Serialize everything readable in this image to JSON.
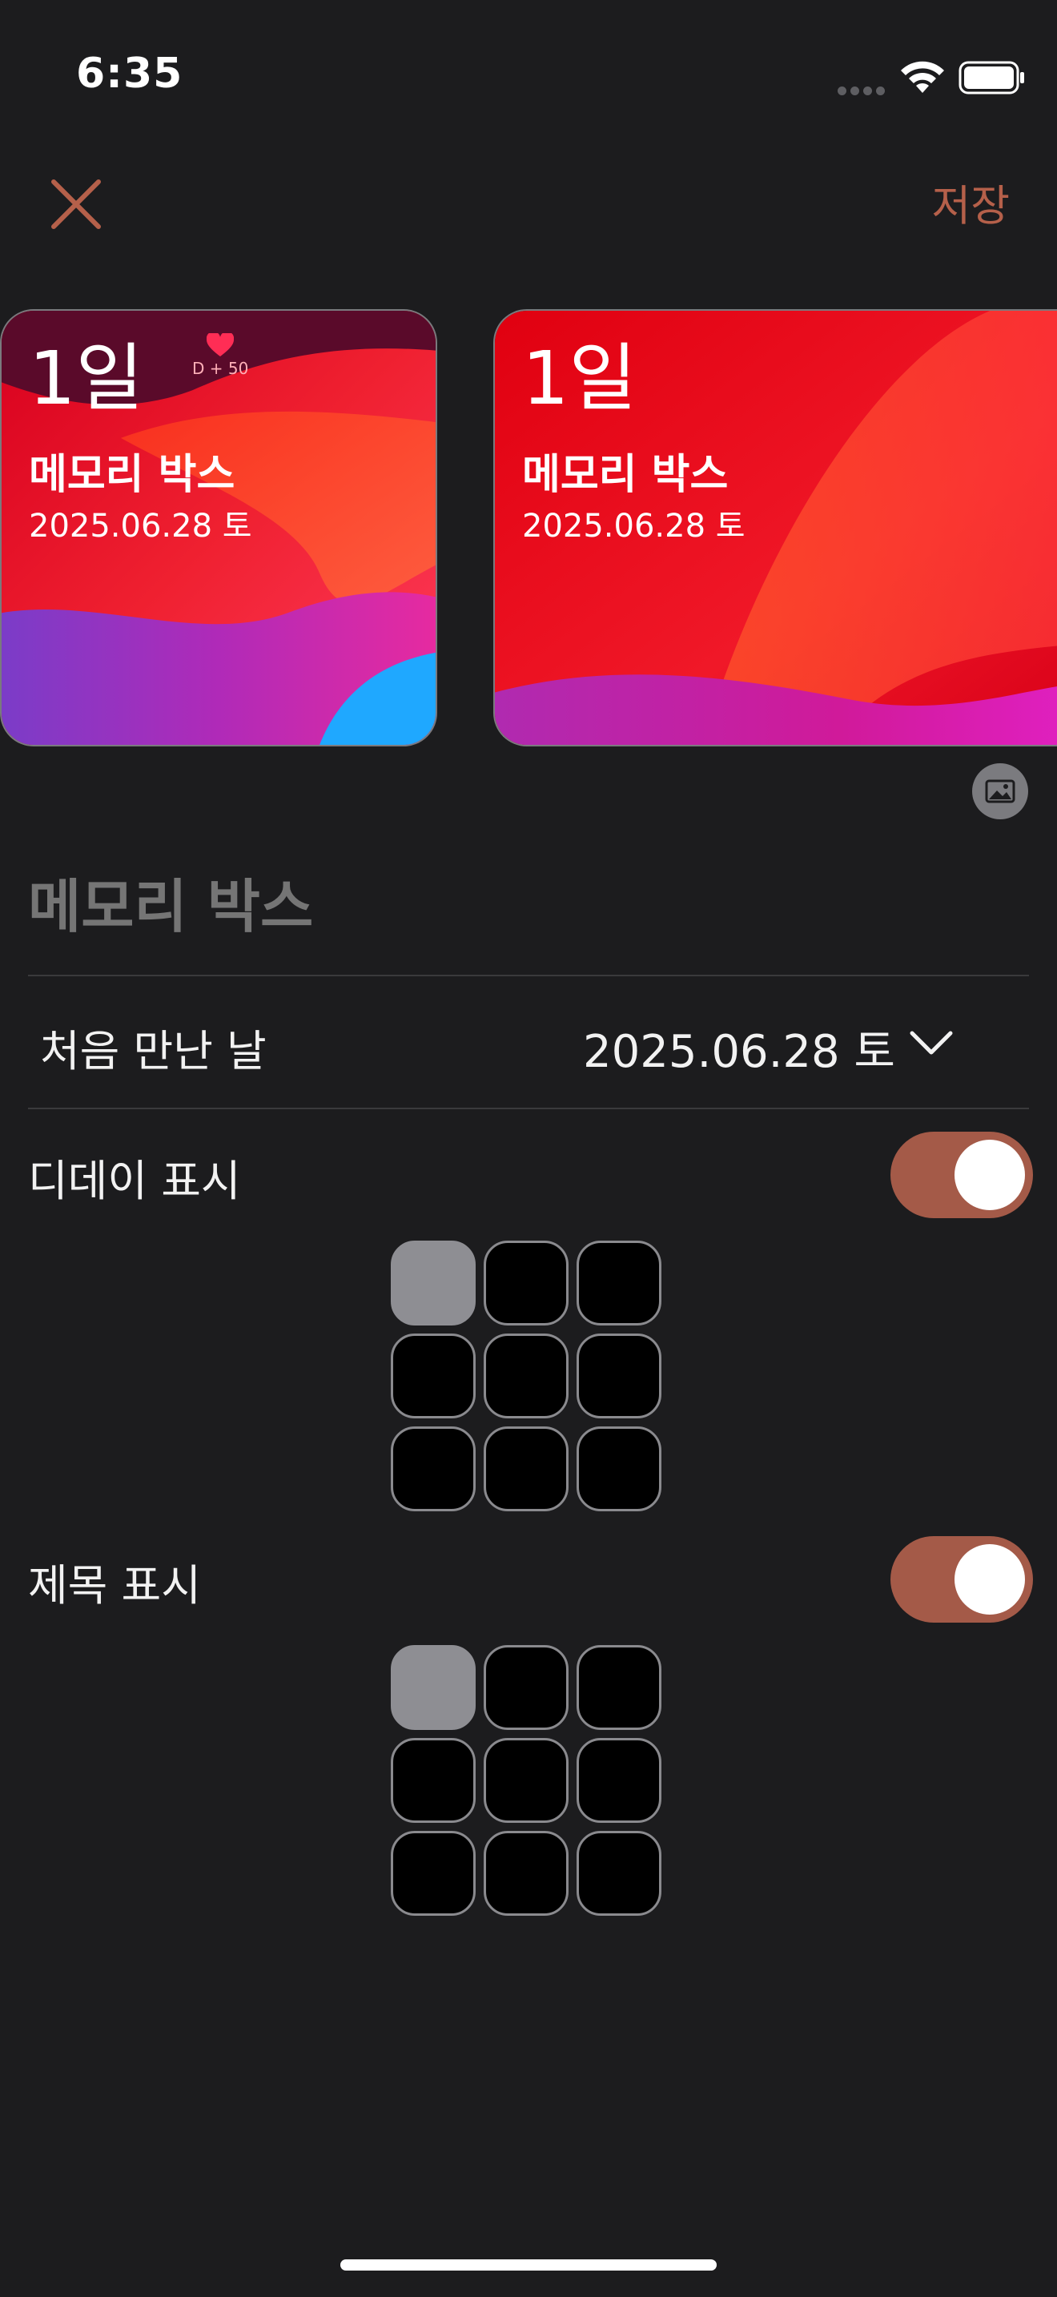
{
  "status_bar": {
    "time": "6:35"
  },
  "nav": {
    "save_label": "저장"
  },
  "widgets": [
    {
      "days": "1일",
      "title": "메모리 박스",
      "date": "2025.06.28 토",
      "badge": "D + 50"
    },
    {
      "days": "1일",
      "title": "메모리 박스",
      "date": "2025.06.28 토"
    }
  ],
  "form": {
    "title_placeholder": "메모리 박스",
    "first_met_label": "처음 만난 날",
    "first_met_value": "2025.06.28 토",
    "dday_label": "디데이 표시",
    "dday_enabled": true,
    "dday_position_selected": 0,
    "title_label": "제목 표시",
    "title_enabled": true,
    "title_position_selected": 0
  },
  "colors": {
    "accent": "#b5604a",
    "toggle_on": "#a45a48",
    "background": "#1c1c1e"
  },
  "icons": [
    "close-icon",
    "wifi-icon",
    "battery-icon",
    "heart-icon",
    "image-icon",
    "chevron-down-icon"
  ]
}
